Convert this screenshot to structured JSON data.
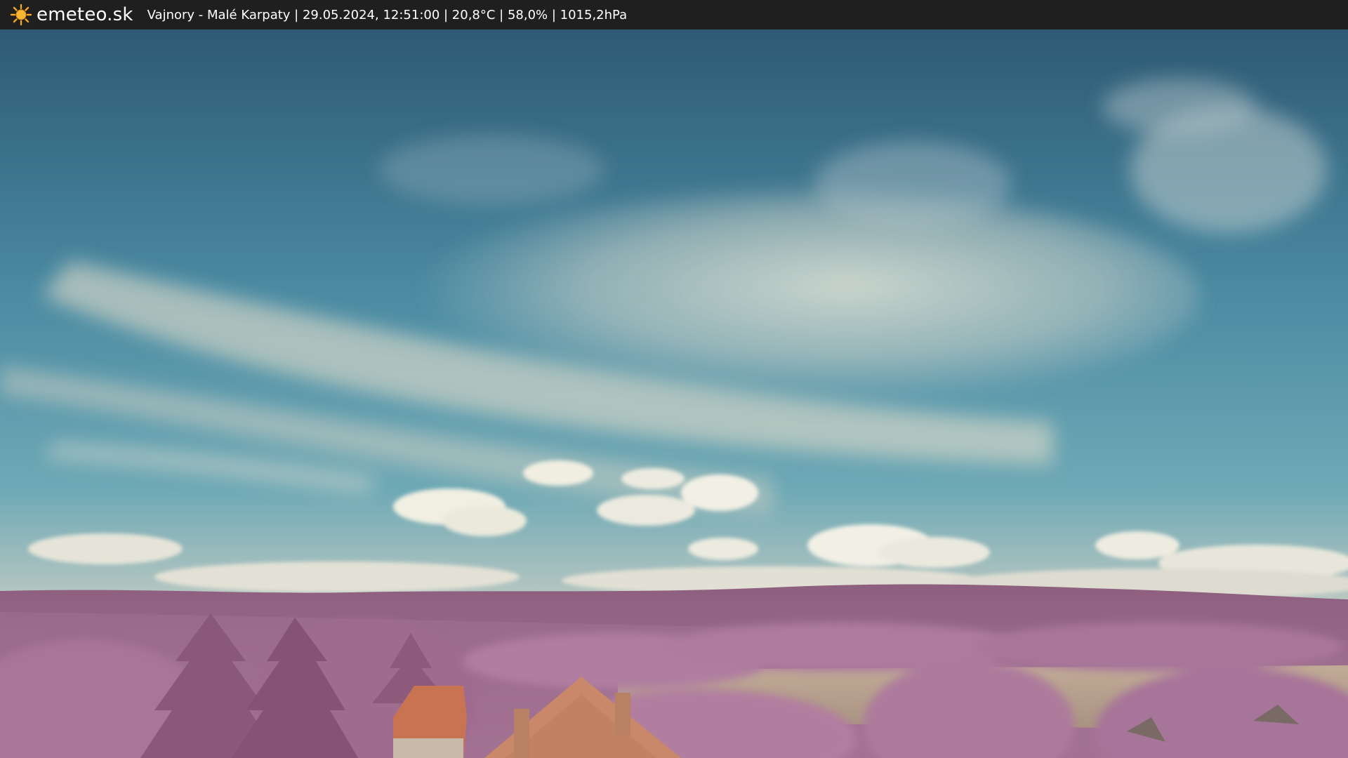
{
  "header": {
    "brand": "emeteo.sk",
    "logo_icon": "sun-icon",
    "caption": "Vajnory - Malé Karpaty | 29.05.2024, 12:51:00 | 20,8°C | 58,0% | 1015,2hPa"
  },
  "colors": {
    "header_bg": "#1f1f1f",
    "sun": "#f5a623",
    "sky_top": "#2f5e78",
    "sky_mid": "#4f8fa6",
    "cloud": "#e6e3d2",
    "hills": "#9c6a8a",
    "foliage": "#b27ea0",
    "roof": "#c8734f",
    "field": "#b8a28f"
  }
}
